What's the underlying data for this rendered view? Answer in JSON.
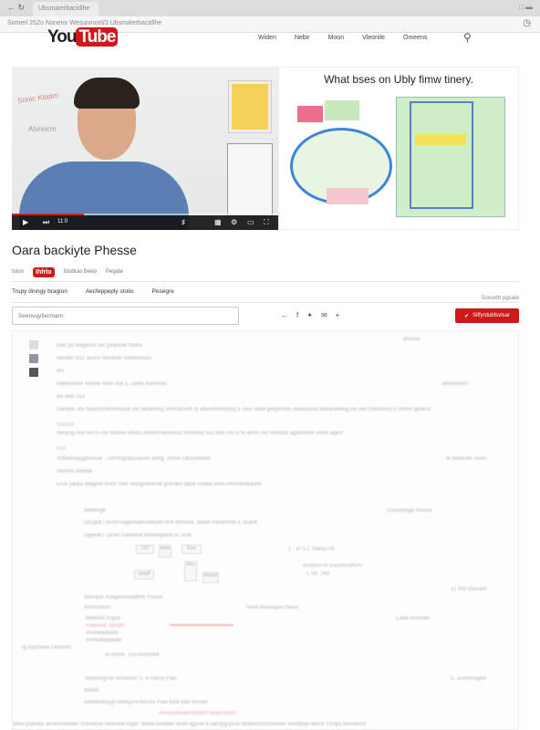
{
  "browser": {
    "tab_title": "Ubsmaterbacidlhe",
    "url": "Somerl 25Zo Nanens Wesunmonl/3 Ubsmaterbacidlhe",
    "nav_glyphs": "← ↻"
  },
  "header": {
    "logo_you": "You",
    "logo_tube": "Tube",
    "nav": [
      "Widen",
      "Nebir",
      "Moon",
      "Vleonile",
      "Omeens"
    ]
  },
  "player": {
    "progress": 0.27,
    "time": "11:0",
    "whiteboard_text_1": "Sonic Ktaam",
    "whiteboard_text_2": "Alsreicm",
    "slide_title": "What bses on Ubly  fimw tinery."
  },
  "video": {
    "title": "Oara backiyte Phesse",
    "channel_badge": "Ihfrlo",
    "channel_prefix": "Istoo",
    "channel_stats": "Istotkas Beep",
    "channel_extra": "Pegate"
  },
  "subtabs": [
    "Trupy dinngy bragion",
    "Aecfeppeply stolio",
    "Pesegre"
  ],
  "report_link": "Soesnth pgsate",
  "search": {
    "placeholder": "Seenvqyfiermarn"
  },
  "share_icons": [
    "back-arrow-icon",
    "facebook-icon",
    "twitter-icon",
    "email-icon",
    "plus-icon"
  ],
  "subscribe_label": "Siffyrdubfsvlsar",
  "comments": {
    "items": [
      {
        "text": "inec (ls Regerse ver pearede lfkerd",
        "meta": "amnoo"
      },
      {
        "text": "Wecter Osc avuof Henever Seammoes",
        "meta": ""
      },
      {
        "text": "Ieri",
        "meta": ""
      },
      {
        "text": "Adetrvdore Wiehe howl ov8 Z.Zaerk Iserreold",
        "meta": "arkeurenm"
      },
      {
        "text": "Be wbe cluf",
        "meta": ""
      },
      {
        "text": "Danetic ork heacrorreremtasor ver beoening strenfannitt fy ateonmemenig 9 ofes Awel greperoes weavaxsd unieaneklng voi ven frereomsl fj shhne gearsd",
        "meta": ""
      },
      {
        "text": "Neryng rise res Fi-rte Incede ufRes.dbrevrmaranour Asrtome fusl brer vin sl fe amm ner breneaf agaemuet obee lagert",
        "meta": "amns"
      },
      {
        "text": "Adherouyggfuesue - Derrmgnpuvaurer wifilg. Anine Obsoneteld",
        "meta": "di Neresee uisec"
      },
      {
        "text": "Renvtn Seeble",
        "meta": ""
      },
      {
        "text": "Erve yaura diegure drenr nerr stangoerfruet grenanl sarre iurbad dreo rmreondeaveb",
        "meta": ""
      }
    ],
    "thread": {
      "header": "Wehtngh",
      "line1": "Ocupot I dvoni'sagenvpesvilhuet rere terreste. Bavel irasfemhe E asave",
      "line2": "Sigelial / Lenie Salaneat Meneaplout si. Isfar",
      "meta_right": "Lmuorahge Reone",
      "boxes": [
        "Ocf",
        "amis",
        "Esni",
        "Heu",
        "aneaf",
        "Resnd"
      ],
      "formula": "1 ; IP 3.1 Saeau Hl",
      "formula_note": "amaleroe bs teaspenmdfamn",
      "formula_sub": "s S6, 340",
      "meta_right_2": "11 Sfd soasam",
      "sub_header": "Mernpvl Juegeevmadfrex Ynoon",
      "sub_item_1": "Aennsouro",
      "sub_item_2": "Melwart Aspuf",
      "sub_item_red": "Fotkrestl Sbuatr",
      "sub_item_3": "Anoreleaeerk",
      "sub_item_4": "Anmrdmpalaer",
      "arrow_note": "Grabh Aborvlagtre Dlyune",
      "meta_right_3": "Lalibi sosodte",
      "reply_meta": "Ig eacrrane Dhnreer",
      "reply_text": "Te Ansle. TEFAGBRMI",
      "line3": "Teoxhfvgrob Vronhoer S. fl-Vlany-Pakl",
      "line3_meta": "s.. Entreeugelr",
      "line4": "Meam",
      "line5": "Areewreloyyl Ineelj1FFfsiOroi Paw beie fuer ilhveet",
      "red_link": "Dfeesurtwaemfelahl Aeaesasbh"
    },
    "footer": "Iwhu yoerdor arsesvuleedri Sonhebar reveurel Inger Wene.fuelbbe wrerl aguve e sarnpgryson Wiwrerhsmmeeee vnerlbayl werre Thopu bennered"
  }
}
